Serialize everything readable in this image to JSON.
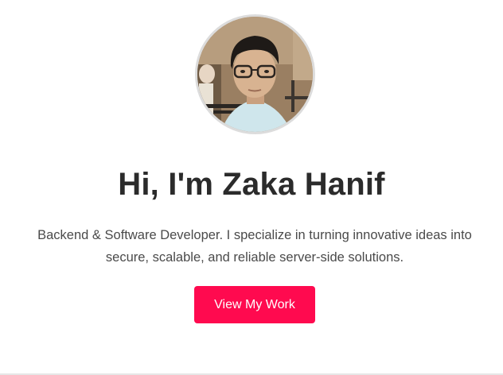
{
  "hero": {
    "heading": "Hi, I'm Zaka Hanif",
    "tagline": "Backend & Software Developer. I specialize in turning innovative ideas into secure, scalable, and reliable server-side solutions.",
    "cta_label": "View My Work",
    "avatar_alt": "Zaka Hanif"
  },
  "colors": {
    "accent": "#ff0a4f",
    "heading": "#2b2b2b",
    "text": "#4a4a4a",
    "background": "#ffffff"
  }
}
